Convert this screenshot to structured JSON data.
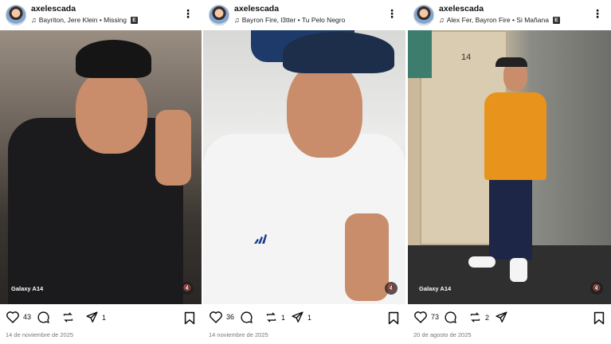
{
  "posts": [
    {
      "username": "axelescada",
      "music": "Bayriton, Jere Klein • Missing",
      "explicit": "E",
      "device_label": "Galaxy A14",
      "likes": "43",
      "comments": "",
      "reposts": "",
      "shares": "1",
      "date": "14 de noviembre de 2025"
    },
    {
      "username": "axelescada",
      "music": "Bayron Fire, l3tter • Tu Pelo Negro",
      "explicit": "",
      "device_label": "",
      "likes": "36",
      "comments": "",
      "reposts": "1",
      "shares": "1",
      "date": "14 noviembre de 2025"
    },
    {
      "username": "axelescada",
      "music": "Alex Fer, Bayron Fire • Si Mañana",
      "explicit": "E",
      "device_label": "Galaxy A14",
      "door_number": "14",
      "likes": "73",
      "comments": "",
      "reposts": "2",
      "shares": "",
      "date": "20 de agosto de 2025"
    }
  ],
  "icons": [
    "avatar",
    "music-note-icon",
    "explicit-badge",
    "more-icon",
    "mute-icon",
    "heart-icon",
    "comment-icon",
    "repost-icon",
    "share-icon",
    "bookmark-icon"
  ]
}
